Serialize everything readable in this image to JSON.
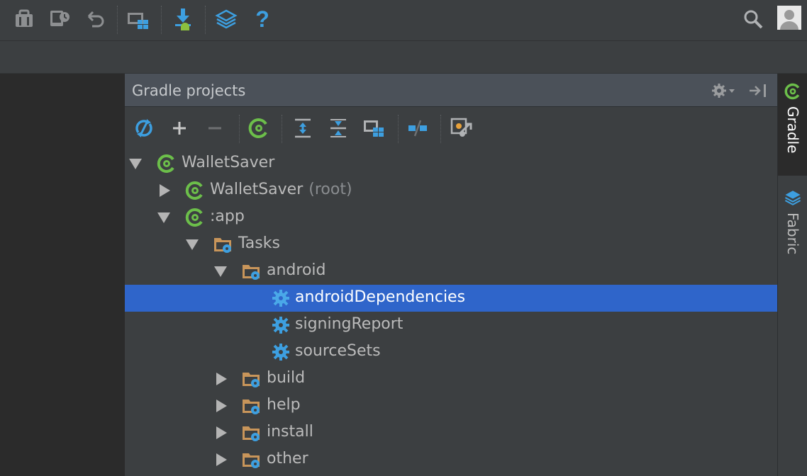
{
  "main_toolbar": {
    "buttons": [
      {
        "name": "sdk-manager-icon"
      },
      {
        "name": "avd-manager-icon"
      },
      {
        "name": "undo-icon"
      },
      {
        "name": "project-structure-icon"
      },
      {
        "name": "android-download-icon"
      },
      {
        "name": "fabric-layers-icon"
      },
      {
        "name": "help-icon",
        "label": "?"
      }
    ],
    "search_icon": "search-icon",
    "avatar": "user-avatar"
  },
  "panel": {
    "title": "Gradle projects",
    "header_buttons": [
      "gear-icon",
      "hide-panel-icon"
    ],
    "toolbar": [
      "refresh-icon",
      "add-icon",
      "remove-icon",
      "execute-task-icon",
      "expand-all-icon",
      "collapse-all-icon",
      "group-modules-icon",
      "toggle-offline-icon",
      "gradle-settings-icon"
    ]
  },
  "tree": [
    {
      "label": "WalletSaver",
      "suffix": "",
      "icon": "gradle-icon",
      "expanded": true
    },
    {
      "label": "WalletSaver",
      "suffix": "(root)",
      "icon": "gradle-icon",
      "expanded": false
    },
    {
      "label": ":app",
      "suffix": "",
      "icon": "gradle-icon",
      "expanded": true
    },
    {
      "label": "Tasks",
      "suffix": "",
      "icon": "task-folder-icon",
      "expanded": true
    },
    {
      "label": "android",
      "suffix": "",
      "icon": "task-folder-icon",
      "expanded": true
    },
    {
      "label": "androidDependencies",
      "suffix": "",
      "icon": "task-gear-icon",
      "selected": true
    },
    {
      "label": "signingReport",
      "suffix": "",
      "icon": "task-gear-icon"
    },
    {
      "label": "sourceSets",
      "suffix": "",
      "icon": "task-gear-icon"
    },
    {
      "label": "build",
      "suffix": "",
      "icon": "task-folder-icon",
      "expanded": false
    },
    {
      "label": "help",
      "suffix": "",
      "icon": "task-folder-icon",
      "expanded": false
    },
    {
      "label": "install",
      "suffix": "",
      "icon": "task-folder-icon",
      "expanded": false
    },
    {
      "label": "other",
      "suffix": "",
      "icon": "task-folder-icon",
      "expanded": false
    }
  ],
  "right_stripe": {
    "tabs": [
      {
        "label": "Gradle",
        "active": true
      },
      {
        "label": "Fabric",
        "active": false
      }
    ]
  },
  "colors": {
    "selection": "#2f65ca",
    "gradle_green": "#6cbf4a",
    "icon_blue": "#3d9fe0",
    "folder_tan": "#c8955a"
  }
}
